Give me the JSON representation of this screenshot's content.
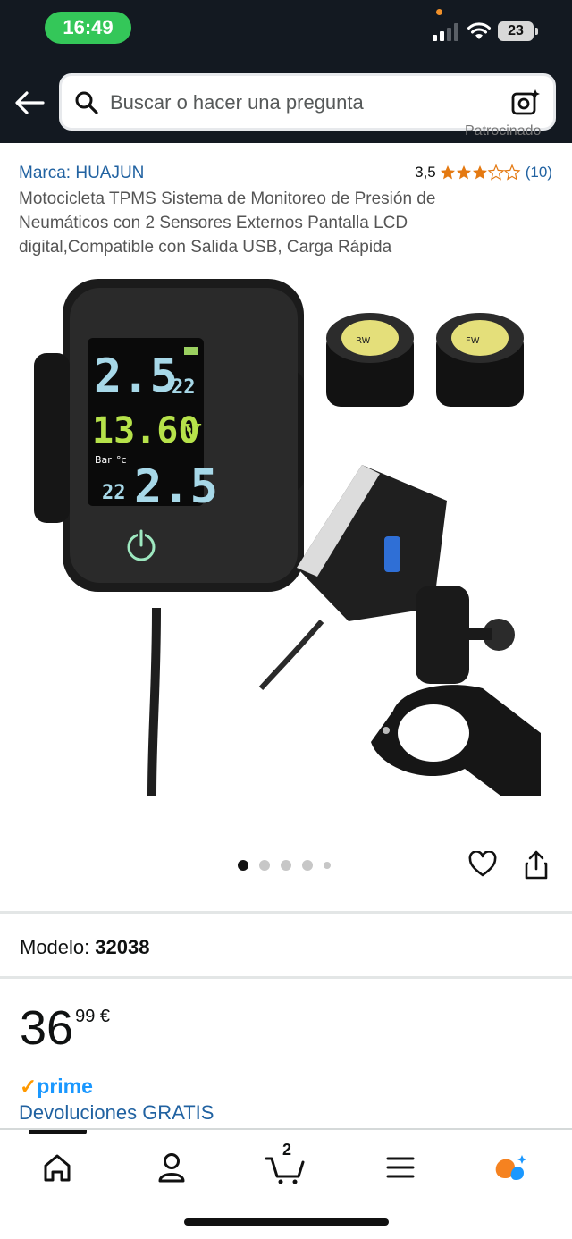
{
  "status_bar": {
    "time": "16:49",
    "battery": "23"
  },
  "search": {
    "placeholder": "Buscar o hacer una pregunta"
  },
  "partial_header_text": "Patrocinado",
  "product": {
    "brand": "Marca: HUAJUN",
    "rating_value": "3,5",
    "rating_stars": 3.5,
    "rating_count": "(10)",
    "title": "Motocicleta TPMS Sistema de Monitoreo de Presión de Neumáticos con 2 Sensores Externos Pantalla LCD digital,Compatible con Salida USB, Carga Rápida",
    "image": {
      "display_top_left": "2.5",
      "display_top_right": "22",
      "display_voltage": "13.60",
      "display_unit": "V",
      "display_bar_label": "Bar",
      "display_c_label": "°c",
      "display_bottom_left": "22",
      "display_bottom_right": "2.5",
      "sensor_left_label": "RW",
      "sensor_right_label": "FW"
    },
    "image_index": 1,
    "image_total": 5,
    "model_label": "Modelo:",
    "model_value": "32038",
    "price_whole": "36",
    "price_fraction": "99 €",
    "prime_label": "prime",
    "returns": "Devoluciones GRATIS"
  },
  "bottom_nav": {
    "cart_count": "2"
  },
  "colors": {
    "header_bg": "#131921",
    "link": "#2162a1",
    "star": "#e47911",
    "prime": "#1a98ff",
    "status_green": "#34c759"
  }
}
